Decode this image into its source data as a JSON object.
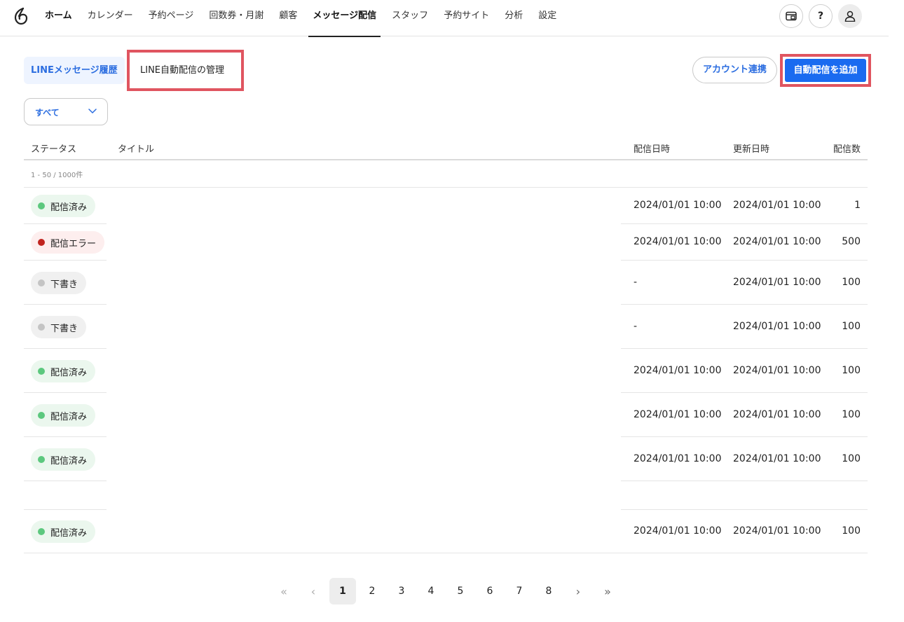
{
  "nav": {
    "items": [
      "ホーム",
      "カレンダー",
      "予約ページ",
      "回数券・月謝",
      "顧客",
      "メッセージ配信",
      "スタッフ",
      "予約サイト",
      "分析",
      "設定"
    ],
    "active_index": 5,
    "help_label": "?"
  },
  "tabs": {
    "line_history": "LINEメッセージ履歴",
    "auto_manage": "LINE自動配信の管理"
  },
  "actions": {
    "account_link": "アカウント連携",
    "add_auto": "自動配信を追加"
  },
  "filter": {
    "selected": "すべて"
  },
  "table": {
    "headers": {
      "status": "ステータス",
      "title": "タイトル",
      "sent_at": "配信日時",
      "updated_at": "更新日時",
      "count": "配信数"
    },
    "count_text": "1 - 50 / 1000件",
    "rows": [
      {
        "status": "配信済み",
        "kind": "ok",
        "sent_at": "2024/01/01 10:00",
        "updated_at": "2024/01/01 10:00",
        "count": "1"
      },
      {
        "status": "配信エラー",
        "kind": "err",
        "sent_at": "2024/01/01 10:00",
        "updated_at": "2024/01/01 10:00",
        "count": "500"
      },
      {
        "status": "下書き",
        "kind": "draft",
        "sent_at": "-",
        "updated_at": "2024/01/01 10:00",
        "count": "100"
      },
      {
        "status": "下書き",
        "kind": "draft",
        "sent_at": "-",
        "updated_at": "2024/01/01 10:00",
        "count": "100"
      },
      {
        "status": "配信済み",
        "kind": "ok",
        "sent_at": "2024/01/01 10:00",
        "updated_at": "2024/01/01 10:00",
        "count": "100"
      },
      {
        "status": "配信済み",
        "kind": "ok",
        "sent_at": "2024/01/01 10:00",
        "updated_at": "2024/01/01 10:00",
        "count": "100"
      },
      {
        "status": "配信済み",
        "kind": "ok",
        "sent_at": "2024/01/01 10:00",
        "updated_at": "2024/01/01 10:00",
        "count": "100"
      },
      {
        "status": "配信済み",
        "kind": "ok",
        "sent_at": "2024/01/01 10:00",
        "updated_at": "2024/01/01 10:00",
        "count": "100"
      }
    ]
  },
  "pagination": {
    "pages": [
      "1",
      "2",
      "3",
      "4",
      "5",
      "6",
      "7",
      "8"
    ],
    "current": 1
  }
}
